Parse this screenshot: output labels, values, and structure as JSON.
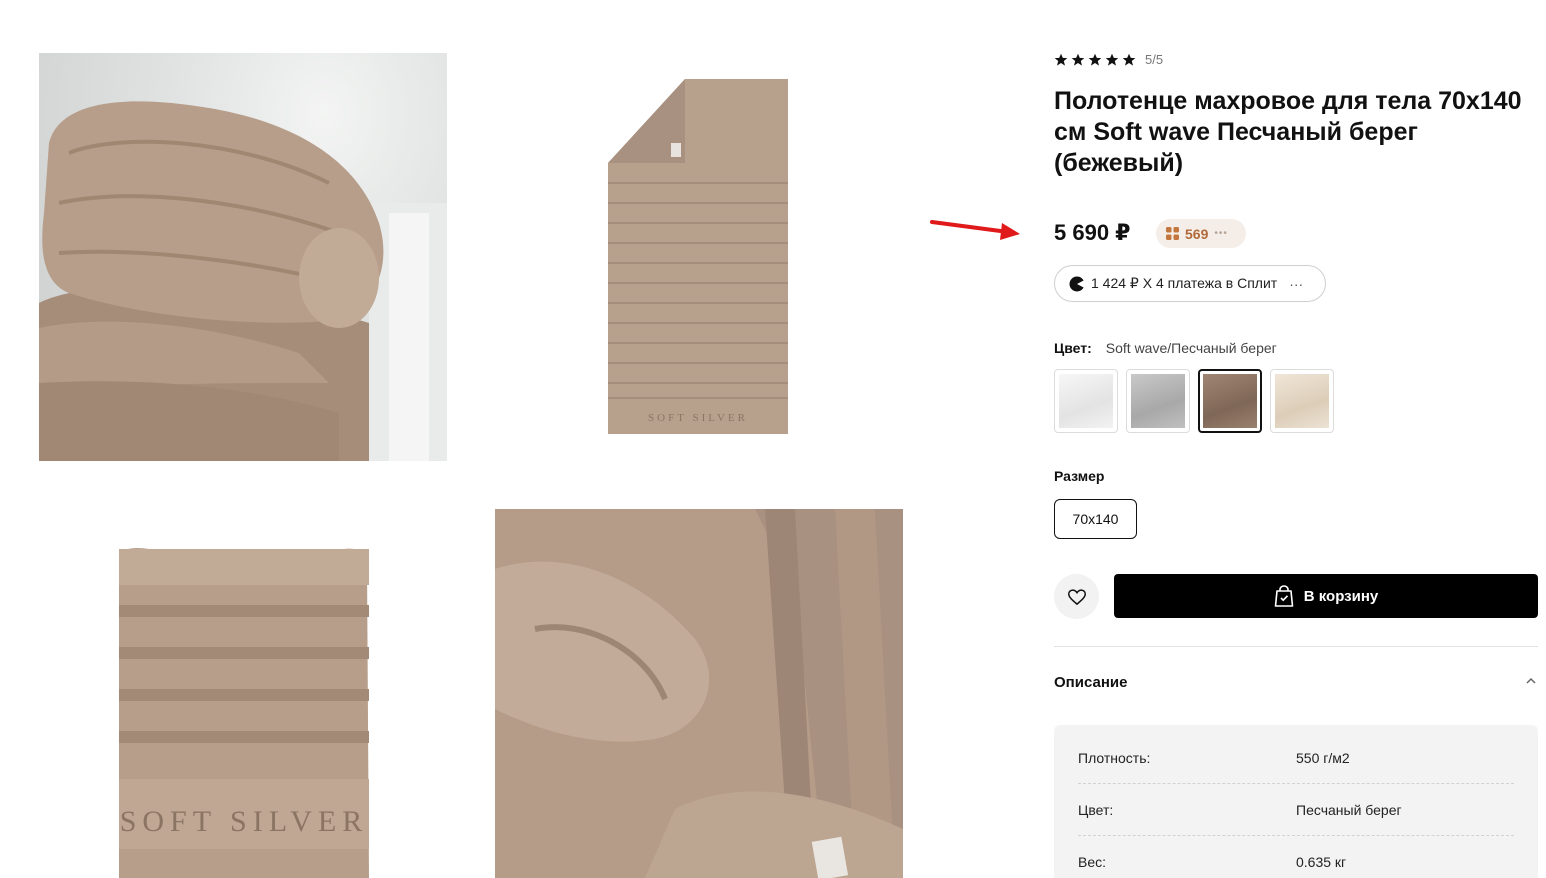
{
  "product": {
    "rating_text": "5/5",
    "title": "Полотенце махровое для тела 70x140 см Soft wave Песчаный берег (бежевый)",
    "price": "5 690 ₽",
    "bonus": "569",
    "bonus_more": "•••",
    "split_text": "1 424 ₽ Х 4 платежа в Сплит",
    "split_more": "···",
    "color_label": "Цвет:",
    "color_value": "Soft wave/Песчаный берег",
    "swatch_colors": [
      "#eeeeee",
      "#b9b9b9",
      "#8f7563",
      "#e8dccb"
    ],
    "size_label": "Размер",
    "size_value": "70x140",
    "cart_label": "В корзину",
    "description_label": "Описание",
    "brand_text": "SOFT SILVER",
    "specs": [
      {
        "key": "Плотность:",
        "value": "550 г/м2"
      },
      {
        "key": "Цвет:",
        "value": "Песчаный берег"
      },
      {
        "key": "Вес:",
        "value": "0.635 кг"
      }
    ]
  },
  "colors": {
    "towel": "#b39b87",
    "towel_dark": "#9c8472",
    "accent_arrow": "#e01a1a",
    "bonus_bg": "#f5ede7",
    "bonus_text": "#b06a3a"
  }
}
